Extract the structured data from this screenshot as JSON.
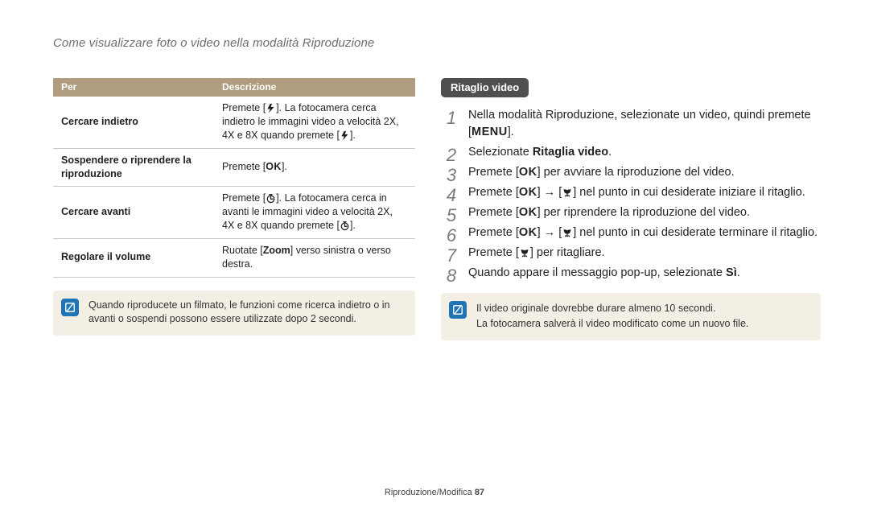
{
  "page_title": "Come visualizzare foto o video nella modalità Riproduzione",
  "table": {
    "headers": [
      "Per",
      "Descrizione"
    ],
    "rows": [
      {
        "k": "Cercare indietro",
        "d_pre": "Premete [",
        "d_icon": "flash",
        "d_mid": "]. La fotocamera cerca indietro le immagini video a velocità 2X, 4X e 8X quando premete [",
        "d_icon2": "flash",
        "d_post": "]."
      },
      {
        "k": "Sospendere o riprendere la riproduzione",
        "d_pre": "Premete [",
        "d_icon": "ok",
        "d_mid": "",
        "d_icon2": "",
        "d_post": "]."
      },
      {
        "k": "Cercare avanti",
        "d_pre": "Premete [",
        "d_icon": "timer",
        "d_mid": "]. La fotocamera cerca in avanti le immagini video a velocità 2X, 4X e 8X quando premete [",
        "d_icon2": "timer",
        "d_post": "]."
      },
      {
        "k": "Regolare il volume",
        "d_pre": "Ruotate [",
        "d_zoom": "Zoom",
        "d_post": "] verso sinistra o verso destra."
      }
    ]
  },
  "left_info": "Quando riproducete un filmato, le funzioni come ricerca indietro o in avanti o sospendi possono essere utilizzate dopo 2 secondi.",
  "section_title": "Ritaglio video",
  "steps": {
    "s1a": "Nella modalità Riproduzione, selezionate un video, quindi premete [",
    "s1b": "].",
    "s2a": "Selezionate ",
    "s2b": "Ritaglia video",
    "s2c": ".",
    "s3a": "Premete [",
    "s3b": "] per avviare la riproduzione del video.",
    "s4a": "Premete [",
    "s4b": "] → [",
    "s4c": "] nel punto in cui desiderate iniziare il ritaglio.",
    "s5a": "Premete [",
    "s5b": "] per riprendere la riproduzione del video.",
    "s6a": "Premete [",
    "s6b": "] → [",
    "s6c": "] nel punto in cui desiderate terminare il ritaglio.",
    "s7a": "Premete [",
    "s7b": "] per ritagliare.",
    "s8a": "Quando appare il messaggio pop-up, selezionate ",
    "s8b": "Sì",
    "s8c": "."
  },
  "right_info_l1": "Il video originale dovrebbe durare almeno 10 secondi.",
  "right_info_l2": "La fotocamera salverà il video modificato come un nuovo file.",
  "footer_text": "Riproduzione/Modifica  ",
  "footer_page": "87",
  "glyphs": {
    "ok": "OK",
    "menu": "MENU"
  }
}
